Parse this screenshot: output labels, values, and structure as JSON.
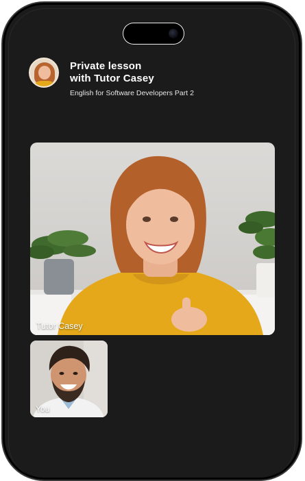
{
  "call": {
    "title_line1": "Private lesson",
    "title_line2": "with Tutor Casey",
    "subtitle": "English for Software Developers Part 2"
  },
  "participants": {
    "main": {
      "label": "Tutor Casey",
      "icon": "tutor-avatar"
    },
    "self": {
      "label": "You"
    }
  },
  "colors": {
    "background": "#1b1b1b",
    "text_primary": "#ffffff",
    "sweater_accent": "#e4a81a"
  }
}
